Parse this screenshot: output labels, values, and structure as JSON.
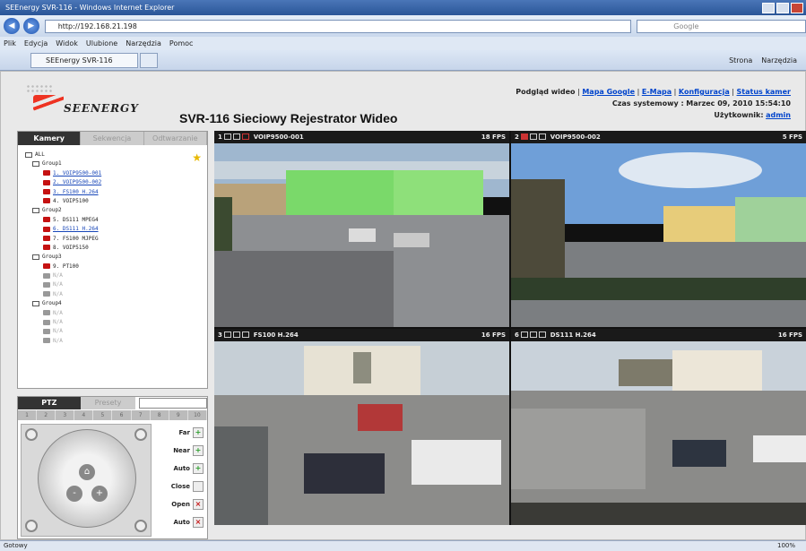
{
  "browser": {
    "window_title": "SEEnergy SVR-116 - Windows Internet Explorer",
    "address": "http://192.168.21.198",
    "search_placeholder": "Google",
    "menu": [
      "Plik",
      "Edycja",
      "Widok",
      "Ulubione",
      "Narzędzia",
      "Pomoc"
    ],
    "tab_label": "SEEnergy SVR-116",
    "commands": [
      "Strona",
      "Narzędzia"
    ],
    "status_left": "Gotowy",
    "zoom": "100%"
  },
  "header": {
    "logo_text": "SEENERGY",
    "title": "SVR-116 Sieciowy Rejestrator Wideo",
    "nav": {
      "current": "Podgląd wideo",
      "links": [
        "Mapa Google",
        "E-Mapa",
        "Konfiguracja",
        "Status kamer"
      ]
    },
    "time_label": "Czas systemowy :",
    "time_value": "Marzec 09, 2010 15:54:10",
    "user_label": "Użytkownik:",
    "user_value": "admin"
  },
  "sidebar": {
    "tabs": [
      "Kamery",
      "Sekwencja",
      "Odtwarzanie"
    ],
    "tree": [
      {
        "kind": "root",
        "label": "ALL"
      },
      {
        "kind": "group",
        "label": "Group1"
      },
      {
        "kind": "cam",
        "label": "1. VOIP9500-001",
        "state": "link"
      },
      {
        "kind": "cam",
        "label": "2. VOIP9500-002",
        "state": "link"
      },
      {
        "kind": "cam",
        "label": "3. FS100 H.264",
        "state": "link"
      },
      {
        "kind": "cam",
        "label": "4. VOIP5100",
        "state": "normal"
      },
      {
        "kind": "group",
        "label": "Group2"
      },
      {
        "kind": "cam",
        "label": "5. DS111 MPEG4",
        "state": "normal"
      },
      {
        "kind": "cam",
        "label": "6. DS111 H.264",
        "state": "link"
      },
      {
        "kind": "cam",
        "label": "7. FS100 MJPEG",
        "state": "normal"
      },
      {
        "kind": "cam",
        "label": "8. VOIP5150",
        "state": "normal"
      },
      {
        "kind": "group",
        "label": "Group3"
      },
      {
        "kind": "cam",
        "label": "9. PT100",
        "state": "normal"
      },
      {
        "kind": "empty",
        "label": "N/A"
      },
      {
        "kind": "empty",
        "label": "N/A"
      },
      {
        "kind": "empty",
        "label": "N/A"
      },
      {
        "kind": "group",
        "label": "Group4"
      },
      {
        "kind": "empty",
        "label": "N/A"
      },
      {
        "kind": "empty",
        "label": "N/A"
      },
      {
        "kind": "empty",
        "label": "N/A"
      },
      {
        "kind": "empty",
        "label": "N/A"
      }
    ]
  },
  "ptz": {
    "tabs": [
      "PTZ",
      "Presety"
    ],
    "presets": [
      "1",
      "2",
      "3",
      "4",
      "5",
      "6",
      "7",
      "8",
      "9",
      "10"
    ],
    "buttons": [
      "Far",
      "Near",
      "Auto",
      "Close",
      "Open",
      "Auto"
    ]
  },
  "cameras": [
    {
      "num": "1",
      "name": "VOIP9500-001",
      "fps": "18 FPS"
    },
    {
      "num": "2",
      "name": "VOIP9500-002",
      "fps": "5 FPS"
    },
    {
      "num": "3",
      "name": "FS100 H.264",
      "fps": "16 FPS"
    },
    {
      "num": "6",
      "name": "DS111 H.264",
      "fps": "16 FPS"
    }
  ]
}
